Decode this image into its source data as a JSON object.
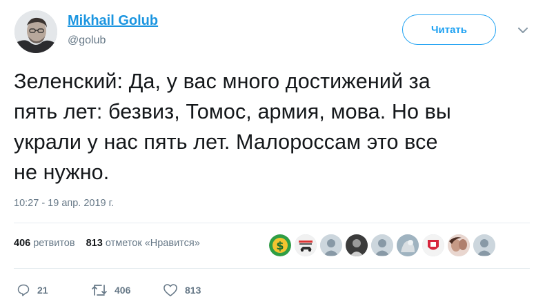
{
  "user": {
    "display_name": "Mikhail Golub",
    "handle": "@golub"
  },
  "follow_button": {
    "label": "Читать"
  },
  "tweet": {
    "lines": [
      "Зеленский: Да, у вас много достижений за",
      "пять лет: безвиз, Томос, армия, мова. Но вы",
      "украли у нас пять лет. Малороссам это все",
      "не нужно."
    ],
    "timestamp": "10:27 - 19 апр. 2019 г."
  },
  "stats": {
    "retweets_count": "406",
    "retweets_label": "ретвитов",
    "likes_count": "813",
    "likes_label": "отметок «Нравится»"
  },
  "actions": {
    "reply_count": "21",
    "retweet_count": "406",
    "like_count": "813"
  },
  "colors": {
    "link": "#1b95e0",
    "accent": "#1da1f2",
    "secondary_text": "#657786",
    "divider": "#e6ecf0"
  }
}
